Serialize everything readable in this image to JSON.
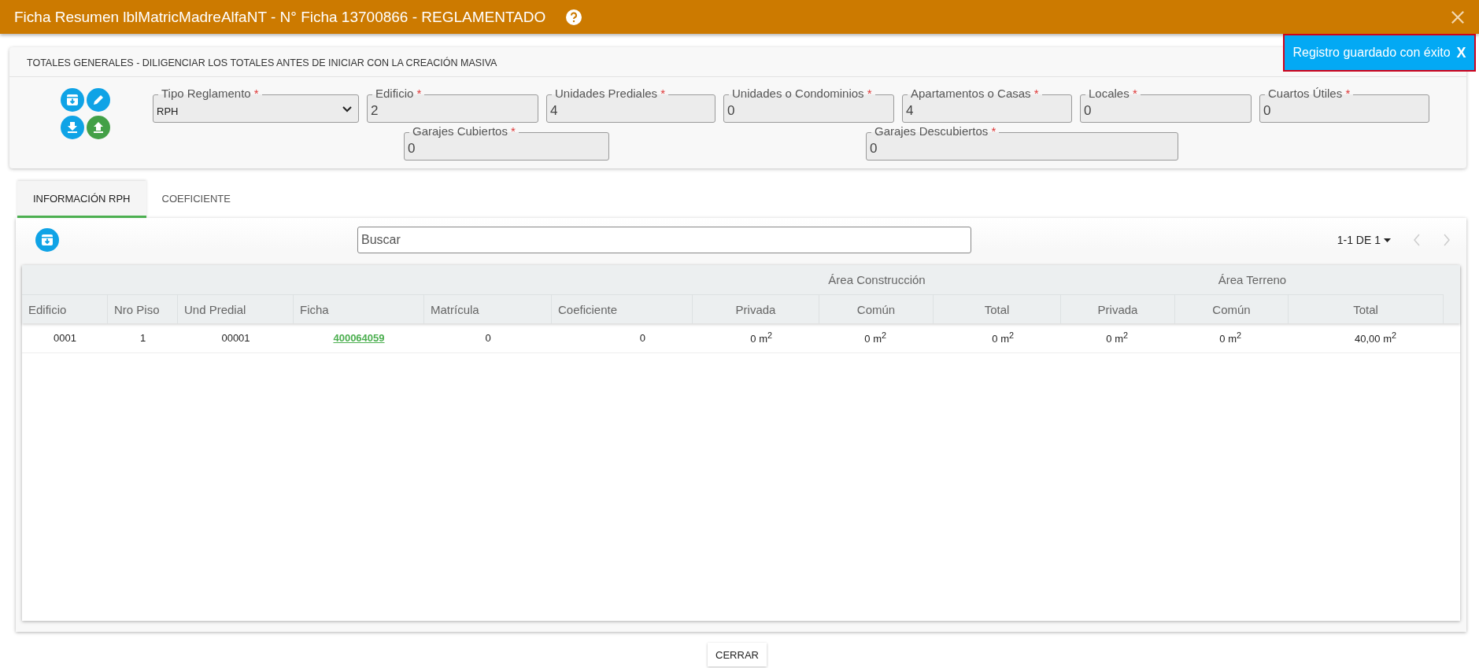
{
  "window": {
    "title": "Ficha Resumen lblMatricMadreAlfaNT - N° Ficha 13700866 - REGLAMENTADO"
  },
  "toast": {
    "text": "Registro guardado con éxito",
    "close": "X"
  },
  "totals": {
    "title": "TOTALES GENERALES - DILIGENCIAR LOS TOTALES ANTES DE INICIAR CON LA CREACIÓN MASIVA",
    "fields": [
      {
        "kind": "select",
        "label": "Tipo Reglamento",
        "required_mark": "*",
        "value": "RPH"
      },
      {
        "kind": "input",
        "label": "Edificio",
        "required_mark": "*",
        "value": "2"
      },
      {
        "kind": "input",
        "label": "Unidades Prediales",
        "required_mark": "*",
        "value": "4"
      },
      {
        "kind": "input",
        "label": "Unidades o Condominios",
        "required_mark": "*",
        "value": "0"
      },
      {
        "kind": "input",
        "label": "Apartamentos o Casas",
        "required_mark": "*",
        "value": "4"
      },
      {
        "kind": "input",
        "label": "Locales",
        "required_mark": "*",
        "value": "0"
      },
      {
        "kind": "input",
        "label": "Cuartos Útiles",
        "required_mark": "*",
        "value": "0"
      },
      {
        "kind": "input",
        "label": "Garajes Cubiertos",
        "required_mark": "*",
        "value": "0"
      },
      {
        "kind": "input",
        "label": "Garajes Descubiertos",
        "required_mark": "*",
        "value": "0"
      }
    ]
  },
  "tabs": [
    {
      "label": "INFORMACIÓN RPH",
      "selected": true
    },
    {
      "label": "COEFICIENTE",
      "selected": false
    }
  ],
  "table": {
    "search": {
      "placeholder": "Buscar"
    },
    "pagination": "1-1 DE 1",
    "columns": [
      "Edificio",
      "Nro Piso",
      "Und Predial",
      "Ficha",
      "Matrícula",
      "Coeficiente"
    ],
    "column_groups": [
      {
        "label": "Área Construcción",
        "columns": [
          "Privada",
          "Común",
          "Total"
        ]
      },
      {
        "label": "Área Terreno",
        "columns": [
          "Privada",
          "Común",
          "Total"
        ]
      }
    ],
    "rows": [
      [
        {
          "kind": "text",
          "text": "0001"
        },
        {
          "kind": "text",
          "text": "1"
        },
        {
          "kind": "text",
          "text": "00001"
        },
        {
          "kind": "link",
          "text": "400064059"
        },
        {
          "kind": "text",
          "text": "0"
        },
        {
          "kind": "number",
          "text": "0"
        },
        {
          "kind": "number",
          "text": "0 m$^{2}$"
        },
        {
          "kind": "number",
          "text": "0 m$^{2}$"
        },
        {
          "kind": "number",
          "text": "0 m$^{2}$"
        },
        {
          "kind": "number",
          "text": "0 m$^{2}$"
        },
        {
          "kind": "number",
          "text": "0 m$^{2}$"
        },
        {
          "kind": "number",
          "text": "40,00 m$^{2}$"
        }
      ]
    ]
  },
  "close_button": "CERRAR"
}
